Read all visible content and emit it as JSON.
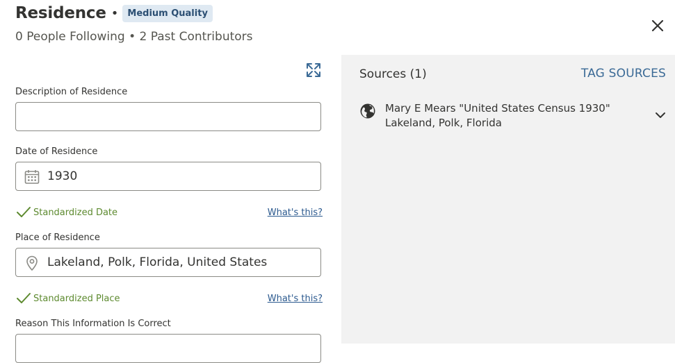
{
  "header": {
    "title": "Residence",
    "bullet": "•",
    "quality_badge": "Medium Quality",
    "subtitle": "0 People Following • 2 Past Contributors",
    "close_icon": "close-icon"
  },
  "form": {
    "expand_icon": "expand-icon",
    "description": {
      "label": "Description of Residence",
      "value": ""
    },
    "date": {
      "label": "Date of Residence",
      "value": "1930",
      "icon": "calendar-icon",
      "standardized_text": "Standardized Date",
      "whats_this": "What's this?"
    },
    "place": {
      "label": "Place of Residence",
      "value": "Lakeland, Polk, Florida, United States",
      "icon": "location-pin-icon",
      "standardized_text": "Standardized Place",
      "whats_this": "What's this?"
    },
    "reason": {
      "label": "Reason This Information Is Correct"
    }
  },
  "sources": {
    "title": "Sources (1)",
    "tag_label": "TAG SOURCES",
    "items": [
      {
        "line1": "Mary E Mears \"United States Census 1930\"",
        "line2": "Lakeland, Polk, Florida",
        "icon": "globe-icon"
      }
    ]
  },
  "colors": {
    "accent_blue": "#3b6a96",
    "badge_bg": "#dfe9f2",
    "success_green": "#5d8a2f",
    "panel_bg": "#f2f2f2"
  }
}
